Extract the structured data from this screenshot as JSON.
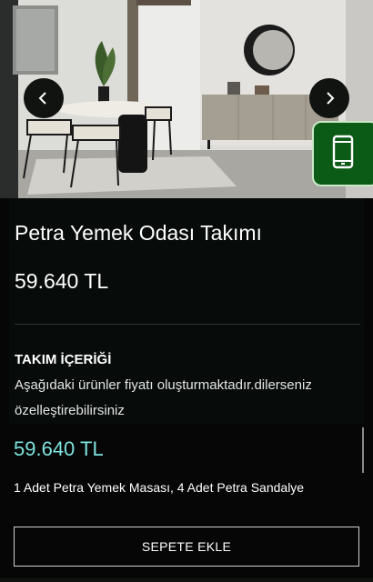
{
  "hero": {
    "image_alt": "Petra dining room set",
    "prev_icon": "chevron-left-icon",
    "next_icon": "chevron-right-icon",
    "contact_icon": "mobile-phone-icon"
  },
  "product": {
    "title": "Petra Yemek Odası Takımı",
    "price": "59.640 TL"
  },
  "set_contents": {
    "heading": "TAKIM İÇERİĞİ",
    "description": "Aşağıdaki ürünler fiyatı oluşturmaktadır.dilerseniz özelleştirebilirsiniz",
    "price": "59.640 TL",
    "items_text": "1 Adet Petra Yemek Masası, 4 Adet Petra Sandalye"
  },
  "actions": {
    "add_to_cart": "SEPETE EKLE"
  },
  "colors": {
    "background": "#050605",
    "accent_price": "#7fe3df",
    "contact_button": "#0b5a16"
  }
}
